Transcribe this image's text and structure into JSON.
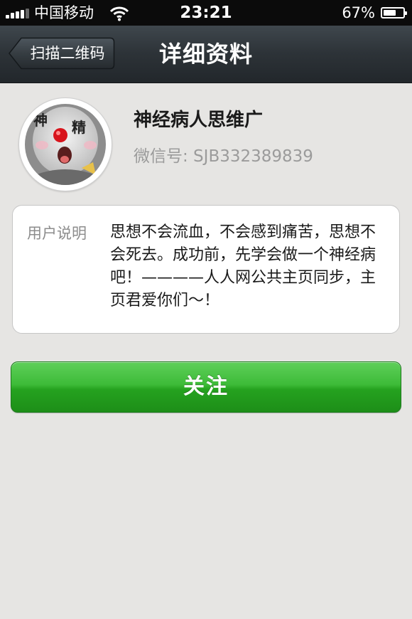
{
  "status_bar": {
    "carrier": "中国移动",
    "time": "23:21",
    "battery_percent": "67%",
    "signal_icon": "signal-bars-icon",
    "wifi_icon": "wifi-icon",
    "battery_icon": "battery-icon",
    "battery_level": 0.67
  },
  "nav": {
    "back_label": "扫描二维码",
    "title": "详细资料"
  },
  "profile": {
    "avatar_icon": "avatar-image",
    "avatar_text": "神 精",
    "name": "神经病人思维广",
    "wechat_id": "微信号: SJB332389839"
  },
  "info": {
    "label": "用户说明",
    "text": "思想不会流血，不会感到痛苦，思想不会死去。成功前，先学会做一个神经病吧！————人人网公共主页同步，主页君爱你们～！"
  },
  "actions": {
    "follow_label": "关注"
  },
  "colors": {
    "background": "#e6e5e3",
    "nav_bar": "#2d3338",
    "follow_green": "#2aa625"
  }
}
